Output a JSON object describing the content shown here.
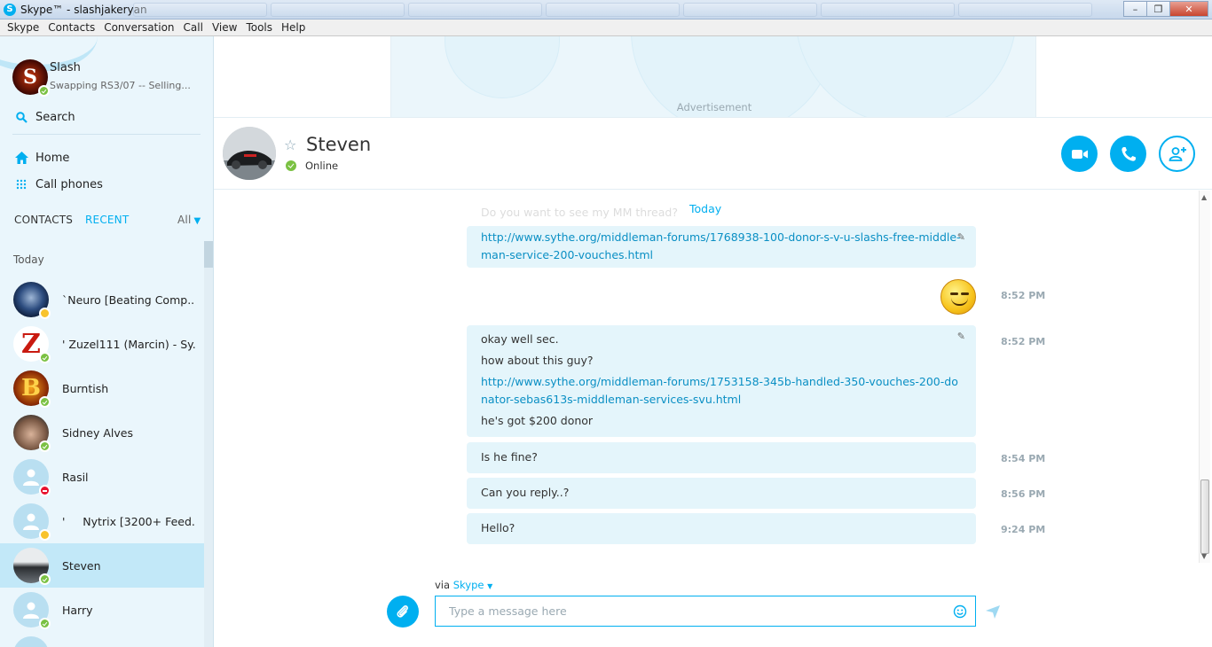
{
  "window": {
    "title": "Skype™ - slashjakeryan",
    "app_icon": "S"
  },
  "menu": [
    "Skype",
    "Contacts",
    "Conversation",
    "Call",
    "View",
    "Tools",
    "Help"
  ],
  "profile": {
    "name": "Slash",
    "mood": "Swapping RS3/07 -- Selling...",
    "status": "online"
  },
  "nav": {
    "search": "Search",
    "home": "Home",
    "call_phones": "Call phones"
  },
  "tabs": {
    "contacts": "CONTACTS",
    "recent": "RECENT",
    "filter": "All"
  },
  "list": {
    "group": "Today",
    "contacts": [
      {
        "name": "`Neuro [Beating Comp...",
        "status": "away"
      },
      {
        "name": "' Zuzel111 (Marcin) - Sy...",
        "status": "online"
      },
      {
        "name": "Burntish",
        "status": "online"
      },
      {
        "name": "Sidney Alves",
        "status": "online"
      },
      {
        "name": "Rasil",
        "status": "dnd"
      },
      {
        "name": "'     Nytrix [3200+ Feed...",
        "status": "away"
      },
      {
        "name": "Steven",
        "status": "online"
      },
      {
        "name": "Harry",
        "status": "online"
      }
    ]
  },
  "ad": {
    "label": "Advertisement"
  },
  "chat": {
    "contact_name": "Steven",
    "presence": "Online",
    "day_label": "Today",
    "faded_message": "Do you want to see my MM thread?",
    "messages": [
      {
        "lines": [],
        "links": [
          "http://www.sythe.org/middleman-forums/1768938-100-donor-s-v-u-slashs-free-middle-man-service-200-vouches.html"
        ],
        "time": ""
      },
      {
        "lines": [
          "okay well sec.",
          "how about this guy?"
        ],
        "links": [
          "http://www.sythe.org/middleman-forums/1753158-345b-handled-350-vouches-200-donator-sebas613s-middleman-services-svu.html"
        ],
        "after": "he's got $200 donor",
        "time": "8:52 PM"
      },
      {
        "lines": [
          "Is he fine?"
        ],
        "time": "8:54 PM"
      },
      {
        "lines": [
          "Can you reply..?"
        ],
        "time": "8:56 PM"
      },
      {
        "lines": [
          "Hello?"
        ],
        "time": "9:24 PM"
      }
    ],
    "emoticon_time": "8:52 PM"
  },
  "composer": {
    "via": "via",
    "via_service": "Skype",
    "placeholder": "Type a message here"
  },
  "colors": {
    "accent": "#00aff0",
    "online": "#7ac142",
    "away": "#f8c32d",
    "dnd": "#e8112d",
    "bubble": "#e4f5fb",
    "sidebar": "#eaf6fc"
  }
}
